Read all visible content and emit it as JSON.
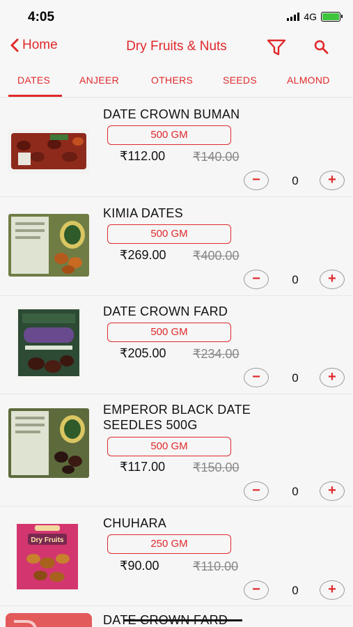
{
  "status": {
    "time": "4:05",
    "network": "4G"
  },
  "nav": {
    "back_label": "Home",
    "title": "Dry Fruits & Nuts"
  },
  "tabs": [
    "DATES",
    "ANJEER",
    "OTHERS",
    "SEEDS",
    "ALMOND"
  ],
  "active_tab": "DATES",
  "colors": {
    "accent": "#e0292b",
    "background": "#f6f6f6",
    "mrp_gray": "#888888"
  },
  "products": [
    {
      "name": "DATE CROWN BUMAN",
      "weight": "500 GM",
      "price": "₹112.00",
      "mrp": "₹140.00",
      "qty": "0",
      "image_icon": "date-crown-buman-pack"
    },
    {
      "name": "KIMIA DATES",
      "weight": "500 GM",
      "price": "₹269.00",
      "mrp": "₹400.00",
      "qty": "0",
      "image_icon": "kimia-dates-pack"
    },
    {
      "name": "DATE CROWN FARD",
      "weight": "500 GM",
      "price": "₹205.00",
      "mrp": "₹234.00",
      "qty": "0",
      "image_icon": "date-crown-fard-pouch"
    },
    {
      "name": "EMPEROR BLACK DATE SEEDLES 500G",
      "weight": "500 GM",
      "price": "₹117.00",
      "mrp": "₹150.00",
      "qty": "0",
      "image_icon": "emperor-black-date-pack"
    },
    {
      "name": "CHUHARA",
      "weight": "250 GM",
      "price": "₹90.00",
      "mrp": "₹110.00",
      "qty": "0",
      "image_icon": "chuhara-dry-fruits-pouch",
      "image_text": "Dry Fruits"
    }
  ],
  "partial_product": {
    "name": "DATE CROWN FARD"
  },
  "qty_controls": {
    "minus": "−",
    "plus": "+"
  }
}
